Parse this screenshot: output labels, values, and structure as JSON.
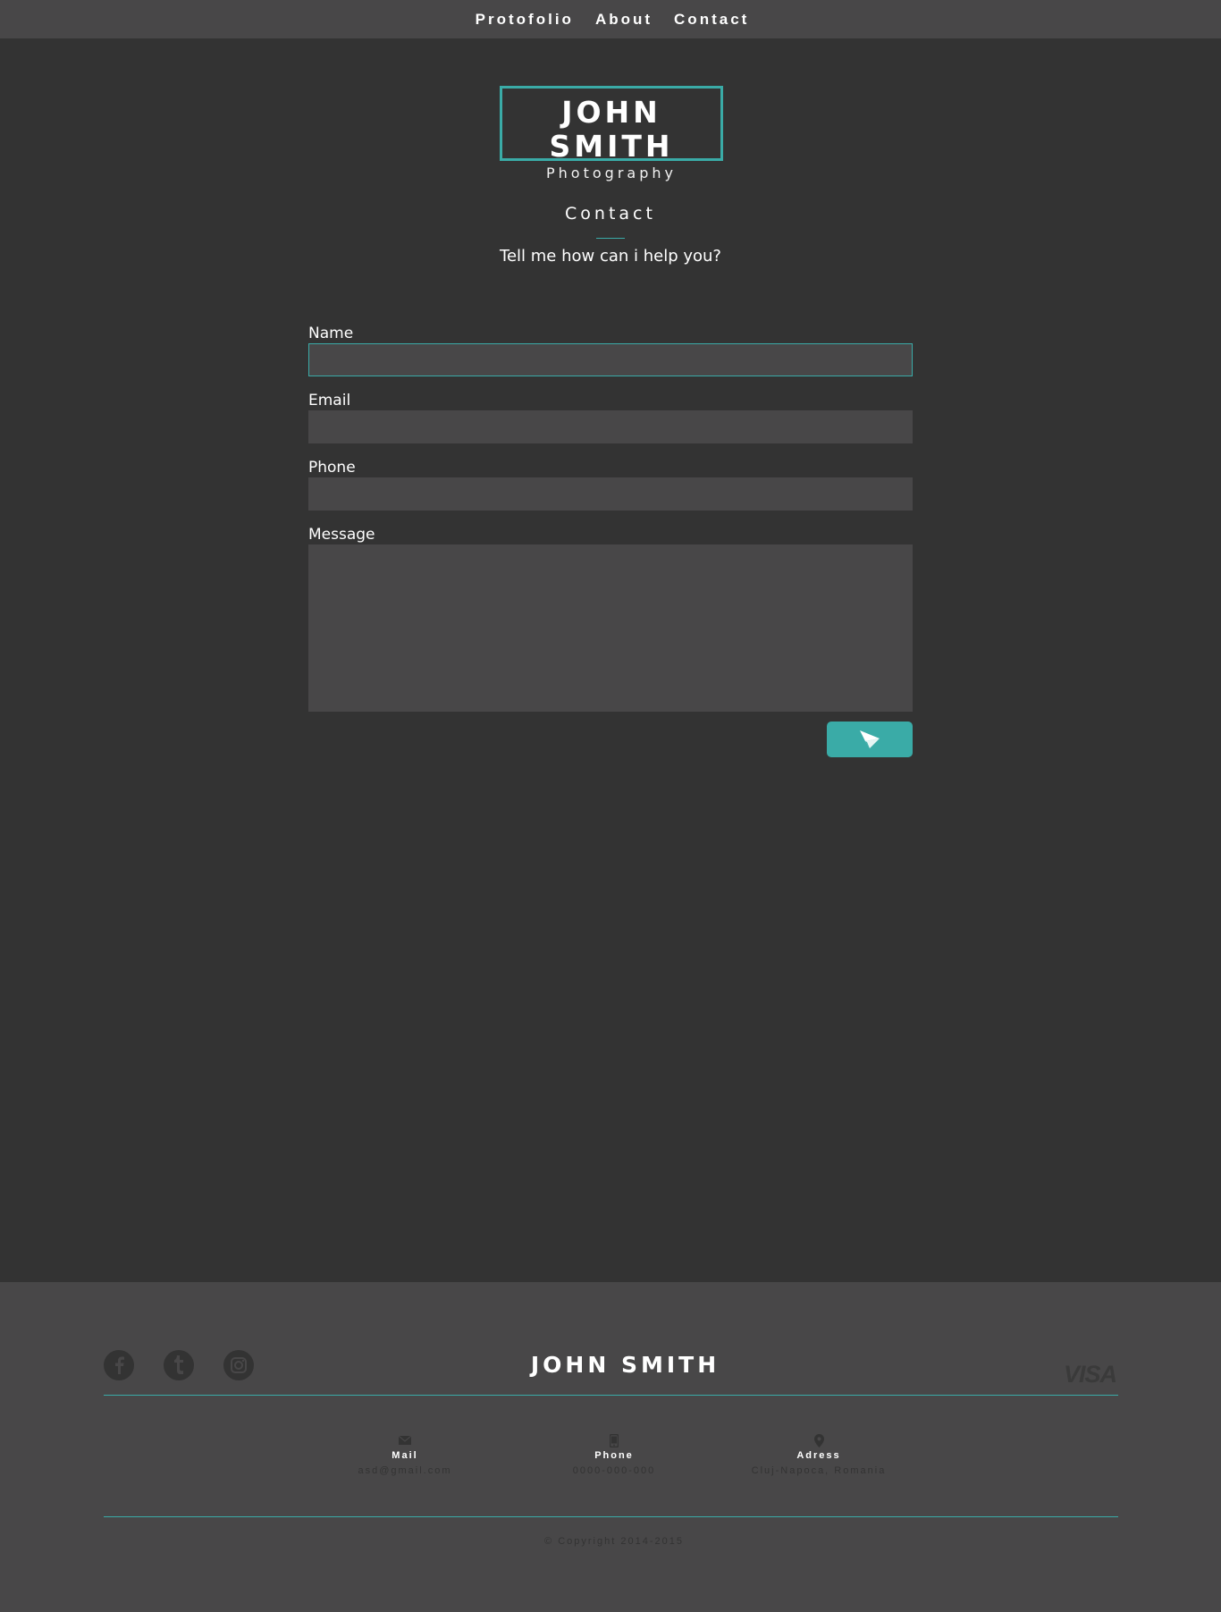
{
  "nav": {
    "items": [
      "Protofolio",
      "About",
      "Contact"
    ]
  },
  "logo": {
    "name": "JOHN SMITH",
    "subtitle": "Photography"
  },
  "page": {
    "title": "Contact",
    "subtitle": "Tell me how can i help you?"
  },
  "form": {
    "name_label": "Name",
    "name_value": "",
    "email_label": "Email",
    "email_value": "",
    "phone_label": "Phone",
    "phone_value": "",
    "message_label": "Message",
    "message_value": "",
    "send_icon": "paper-plane-icon"
  },
  "footer": {
    "social_icons": [
      "facebook-icon",
      "tumblr-icon",
      "instagram-icon"
    ],
    "name": "JOHN SMITH",
    "payment": "VISA",
    "contacts": [
      {
        "icon": "mail-icon",
        "label": "Mail",
        "value": "asd@gmail.com"
      },
      {
        "icon": "phone-icon",
        "label": "Phone",
        "value": "0000-000-000"
      },
      {
        "icon": "map-pin-icon",
        "label": "Adress",
        "value": "Cluj-Napoca, Romania"
      }
    ],
    "copyright": "© Copyright 2014-2015"
  },
  "colors": {
    "accent": "#3aaba7",
    "background": "#333333",
    "panel": "#484748"
  }
}
